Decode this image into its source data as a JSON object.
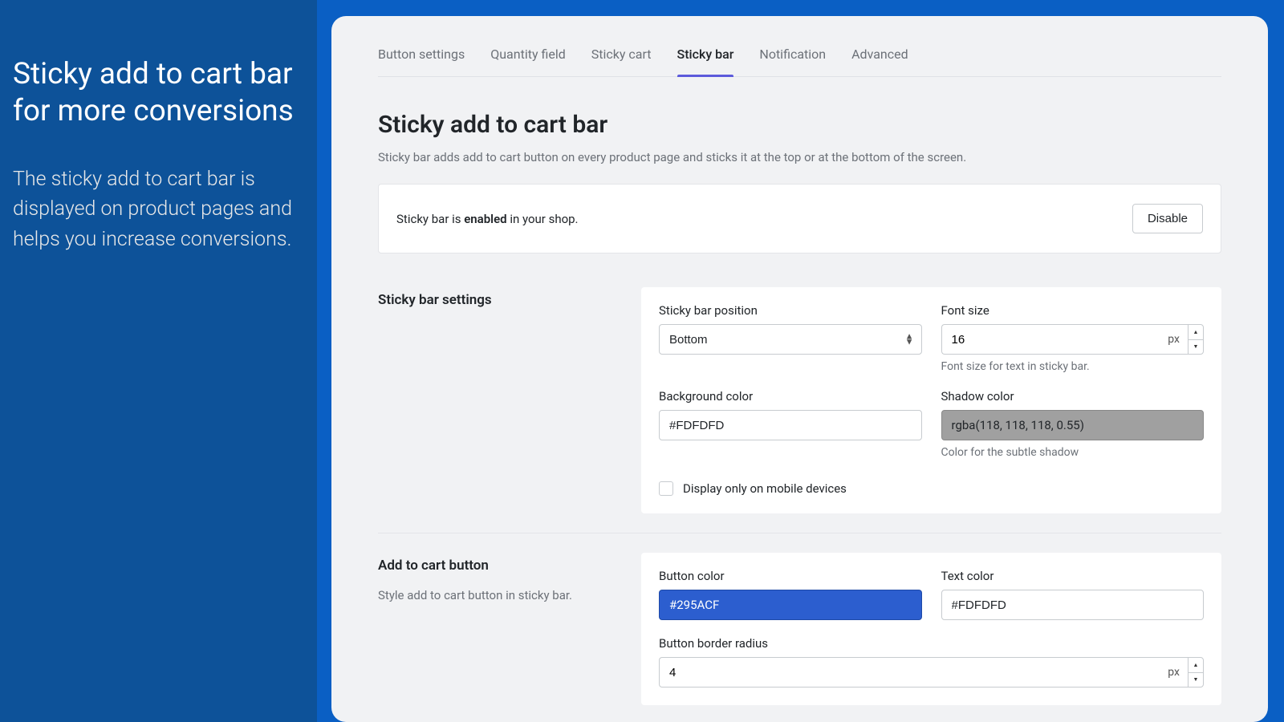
{
  "sidebar": {
    "title": "Sticky add to cart bar for more conversions",
    "desc": "The sticky add to cart bar is displayed on product pages and helps you increase conversions."
  },
  "tabs": [
    "Button settings",
    "Quantity field",
    "Sticky cart",
    "Sticky bar",
    "Notification",
    "Advanced"
  ],
  "page": {
    "title": "Sticky add to cart bar",
    "desc": "Sticky bar adds add to cart button on every product page and sticks it at the top or at the bottom of the screen."
  },
  "status": {
    "prefix": "Sticky bar is ",
    "state": "enabled",
    "suffix": " in your shop.",
    "button": "Disable"
  },
  "section1": {
    "heading": "Sticky bar settings",
    "position_label": "Sticky bar position",
    "position_value": "Bottom",
    "fontsize_label": "Font size",
    "fontsize_value": "16",
    "fontsize_unit": "px",
    "fontsize_help": "Font size for text in sticky bar.",
    "bg_label": "Background color",
    "bg_value": "#FDFDFD",
    "shadow_label": "Shadow color",
    "shadow_value": "rgba(118, 118, 118, 0.55)",
    "shadow_help": "Color for the subtle shadow",
    "mobile_label": "Display only on mobile devices"
  },
  "section2": {
    "heading": "Add to cart button",
    "sub": "Style add to cart button in sticky bar.",
    "btncolor_label": "Button color",
    "btncolor_value": "#295ACF",
    "textcolor_label": "Text color",
    "textcolor_value": "#FDFDFD",
    "radius_label": "Button border radius",
    "radius_value": "4",
    "radius_unit": "px"
  }
}
